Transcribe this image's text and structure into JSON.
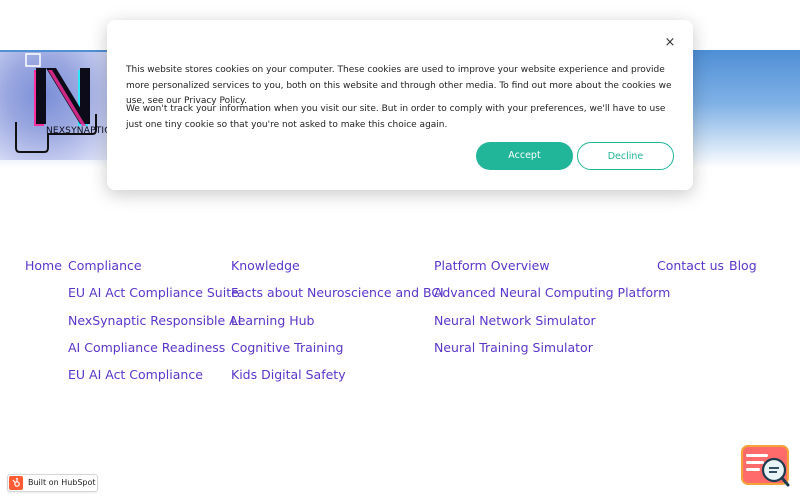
{
  "logo": {
    "text": "NEXSYNAPTIC"
  },
  "nav": {
    "home": "Home",
    "compliance": "Compliance",
    "compliance_items": [
      "EU AI Act Compliance Suite",
      "NexSynaptic Responsible AI",
      "AI Compliance Readiness",
      "EU AI Act Compliance"
    ],
    "knowledge": "Knowledge",
    "knowledge_items": [
      "Facts about Neuroscience and BCI",
      "Learning Hub",
      "Cognitive Training",
      "Kids Digital Safety"
    ],
    "platform": "Platform Overview",
    "platform_items": [
      "Advanced Neural Computing Platform",
      "Neural Network Simulator",
      "Neural Training Simulator"
    ],
    "contact": "Contact us",
    "blog": "Blog"
  },
  "cookie": {
    "close_label": "×",
    "paragraph1": "This website stores cookies on your computer. These cookies are used to improve your website experience and provide more personalized services to you, both on this website and through other media. To find out more about the cookies we use, see our Privacy Policy.",
    "paragraph2": "We won't track your information when you visit our site. But in order to comply with your preferences, we'll have to use just one tiny cookie so that you're not asked to make this choice again.",
    "accept_label": "Accept",
    "decline_label": "Decline"
  },
  "hubspot": {
    "label": "Built on HubSpot"
  },
  "colors": {
    "accent_green": "#21b59a",
    "link_purple": "#5a35c9",
    "hero_blue": "#4f8fd6",
    "hubspot_orange": "#ff5c35"
  },
  "icons": {
    "close": "close-icon",
    "hubspot": "hubspot-sprocket-icon",
    "chat": "chat-search-icon"
  }
}
